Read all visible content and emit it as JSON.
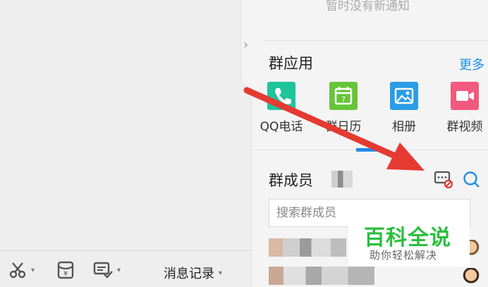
{
  "notice": {
    "text": "暂时没有新通知"
  },
  "group_apps": {
    "title": "群应用",
    "more_label": "更多",
    "items": [
      {
        "label": "QQ电话",
        "icon": "phone-icon",
        "color": "#1ec49a"
      },
      {
        "label": "群日历",
        "icon": "calendar-icon",
        "color": "#66c43a"
      },
      {
        "label": "相册",
        "icon": "album-icon",
        "color": "#2a9de6"
      },
      {
        "label": "群视频",
        "icon": "video-icon",
        "color": "#f05a7f"
      }
    ]
  },
  "members": {
    "title": "群成员",
    "search_placeholder": "搜索群成员"
  },
  "toolbar": {
    "history_label": "消息记录",
    "caret": "▾"
  },
  "watermark": {
    "main": "百科全说",
    "sub": "助你轻松解决"
  },
  "colors": {
    "accent": "#1d8fe6",
    "arrow": "#e53a32",
    "watermark_green": "#2bbf3f"
  }
}
